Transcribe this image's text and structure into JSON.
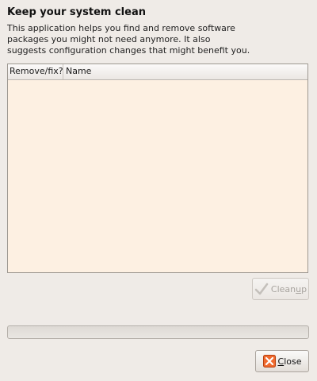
{
  "header": {
    "title": "Keep your system clean",
    "description": "This application helps you find and remove software\npackages you might not need anymore. It also\nsuggests configuration changes that might benefit you."
  },
  "list": {
    "columns": [
      "Remove/fix?",
      "Name"
    ],
    "rows": []
  },
  "buttons": {
    "cleanup": {
      "label_prefix": "Clean",
      "label_mnemonic": "u",
      "label_suffix": "p",
      "icon": "checkmark-icon",
      "enabled": false
    },
    "close": {
      "label_prefix": "",
      "label_mnemonic": "C",
      "label_suffix": "lose",
      "icon": "close-x-icon",
      "enabled": true
    }
  },
  "progress": {
    "fraction": 0
  },
  "colors": {
    "window_bg": "#efebe7",
    "list_bg": "#fdf0e2",
    "close_icon": "#e8501e",
    "disabled_text": "#a8a49f"
  }
}
